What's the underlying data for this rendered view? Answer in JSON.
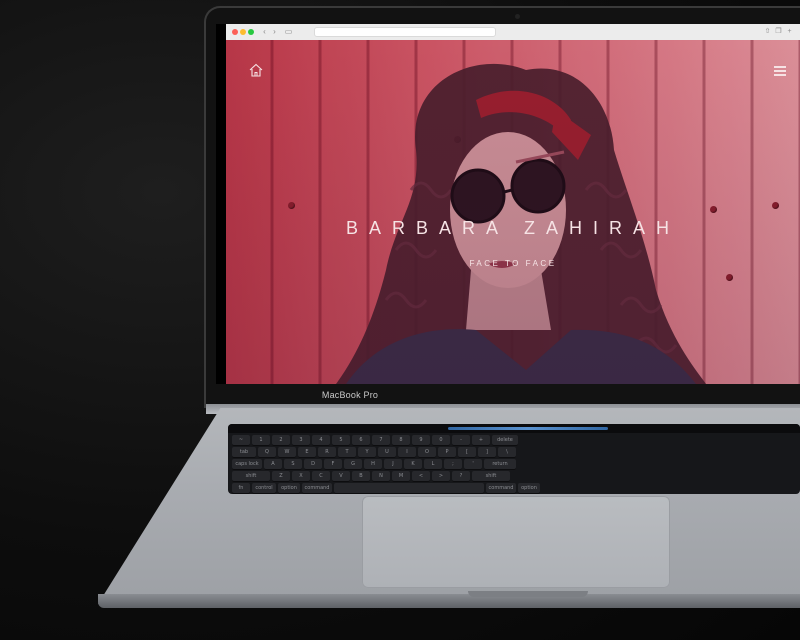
{
  "laptop": {
    "brand_label": "MacBook Pro"
  },
  "browser": {
    "back_icon": "chevron-left-icon",
    "forward_icon": "chevron-right-icon"
  },
  "site": {
    "title": "BARBARA ZAHIRAH",
    "subtitle": "FACE TO FACE",
    "home_icon": "home-icon",
    "menu_icon": "hamburger-menu-icon",
    "accent_color": "#d65a68"
  },
  "keyboard": {
    "rows": [
      [
        "~",
        "1",
        "2",
        "3",
        "4",
        "5",
        "6",
        "7",
        "8",
        "9",
        "0",
        "-",
        "+",
        "delete"
      ],
      [
        "tab",
        "Q",
        "W",
        "E",
        "R",
        "T",
        "Y",
        "U",
        "I",
        "O",
        "P",
        "[",
        "]",
        "\\"
      ],
      [
        "caps lock",
        "A",
        "S",
        "D",
        "F",
        "G",
        "H",
        "J",
        "K",
        "L",
        ";",
        "'",
        "return"
      ],
      [
        "shift",
        "Z",
        "X",
        "C",
        "V",
        "B",
        "N",
        "M",
        "<",
        ">",
        "?",
        "shift"
      ],
      [
        "fn",
        "control",
        "option",
        "command",
        "",
        "command",
        "option"
      ]
    ]
  }
}
